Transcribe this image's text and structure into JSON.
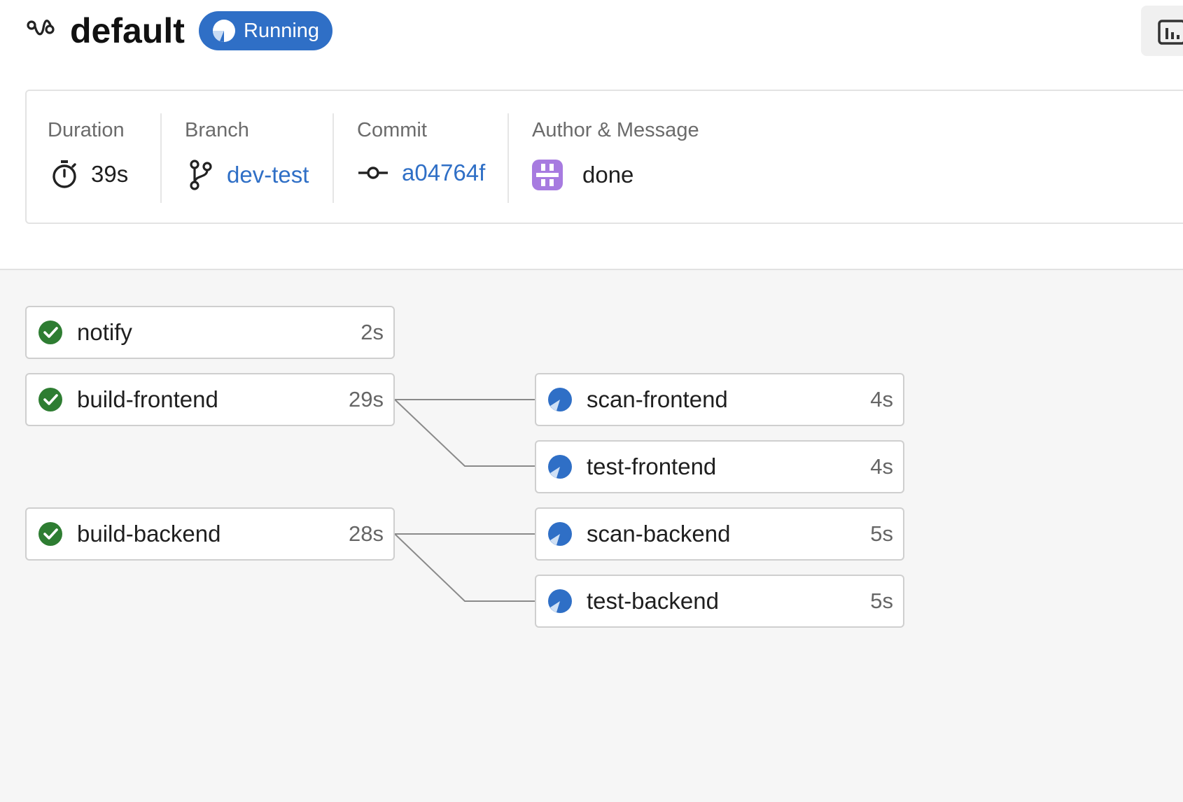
{
  "header": {
    "title": "default",
    "status": "Running",
    "pipeline_icon": "pipeline-icon",
    "action_icon": "chart-bar-icon"
  },
  "info": {
    "duration": {
      "label": "Duration",
      "value": "39s",
      "icon": "stopwatch-icon"
    },
    "branch": {
      "label": "Branch",
      "value": "dev-test",
      "icon": "git-branch-icon"
    },
    "commit": {
      "label": "Commit",
      "value": "a04764f",
      "icon": "git-commit-icon"
    },
    "author": {
      "label": "Author & Message",
      "message": "done",
      "icon": "avatar"
    }
  },
  "jobs": {
    "notify": {
      "name": "notify",
      "duration": "2s",
      "status": "success"
    },
    "build_frontend": {
      "name": "build-frontend",
      "duration": "29s",
      "status": "success"
    },
    "build_backend": {
      "name": "build-backend",
      "duration": "28s",
      "status": "success"
    },
    "scan_frontend": {
      "name": "scan-frontend",
      "duration": "4s",
      "status": "running"
    },
    "test_frontend": {
      "name": "test-frontend",
      "duration": "4s",
      "status": "running"
    },
    "scan_backend": {
      "name": "scan-backend",
      "duration": "5s",
      "status": "running"
    },
    "test_backend": {
      "name": "test-backend",
      "duration": "5s",
      "status": "running"
    }
  },
  "colors": {
    "accent": "#2f6fc6",
    "success": "#2e7d32",
    "avatar": "#9c6ad6"
  }
}
